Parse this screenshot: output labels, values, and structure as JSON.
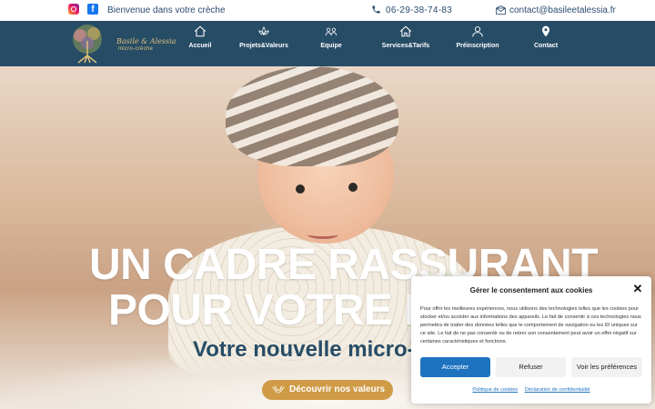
{
  "topbar": {
    "welcome": "Bienvenue dans votre crèche",
    "phone": "06-29-38-74-83",
    "email": "contact@basileetalessia.fr",
    "icons": [
      "instagram-icon",
      "facebook-icon",
      "phone-icon",
      "mail-icon"
    ]
  },
  "brand": {
    "name": "Basile & Alessia",
    "tagline": "micro-crèche"
  },
  "nav": {
    "items": [
      {
        "label": "Accueil",
        "icon": "home-icon"
      },
      {
        "label": "Projets&Valeurs",
        "icon": "lotus-icon"
      },
      {
        "label": "Equipe",
        "icon": "team-icon"
      },
      {
        "label": "Services&Tarifs",
        "icon": "house-icon"
      },
      {
        "label": "Préinscription",
        "icon": "user-icon"
      },
      {
        "label": "Contact",
        "icon": "pin-icon"
      }
    ]
  },
  "hero": {
    "line1": "UN CADRE RASSURANT",
    "line2": "POUR VOTRE E",
    "subtitle": "Votre nouvelle micro-c",
    "cta": "Découvrir nos valeurs"
  },
  "consent": {
    "title": "Gérer le consentement aux cookies",
    "text": "Pour offrir les meilleures expériences, nous utilisons des technologies telles que les cookies pour stocker et/ou accéder aux informations des appareils. Le fait de consentir à ces technologies nous permettra de traiter des données telles que le comportement de navigation ou les ID uniques sur ce site. Le fait de ne pas consentir ou de retirer son consentement peut avoir un effet négatif sur certaines caractéristiques et fonctions.",
    "accept": "Accepter",
    "refuse": "Refuser",
    "preferences": "Voir les préférences",
    "cookie_policy": "Politique de cookies",
    "privacy": "Déclaration de confidentialité",
    "close": "✕"
  },
  "colors": {
    "nav_bg": "#264c66",
    "accent": "#cf9b46",
    "accept": "#1e73be",
    "brand_gold": "#e0c07a"
  }
}
